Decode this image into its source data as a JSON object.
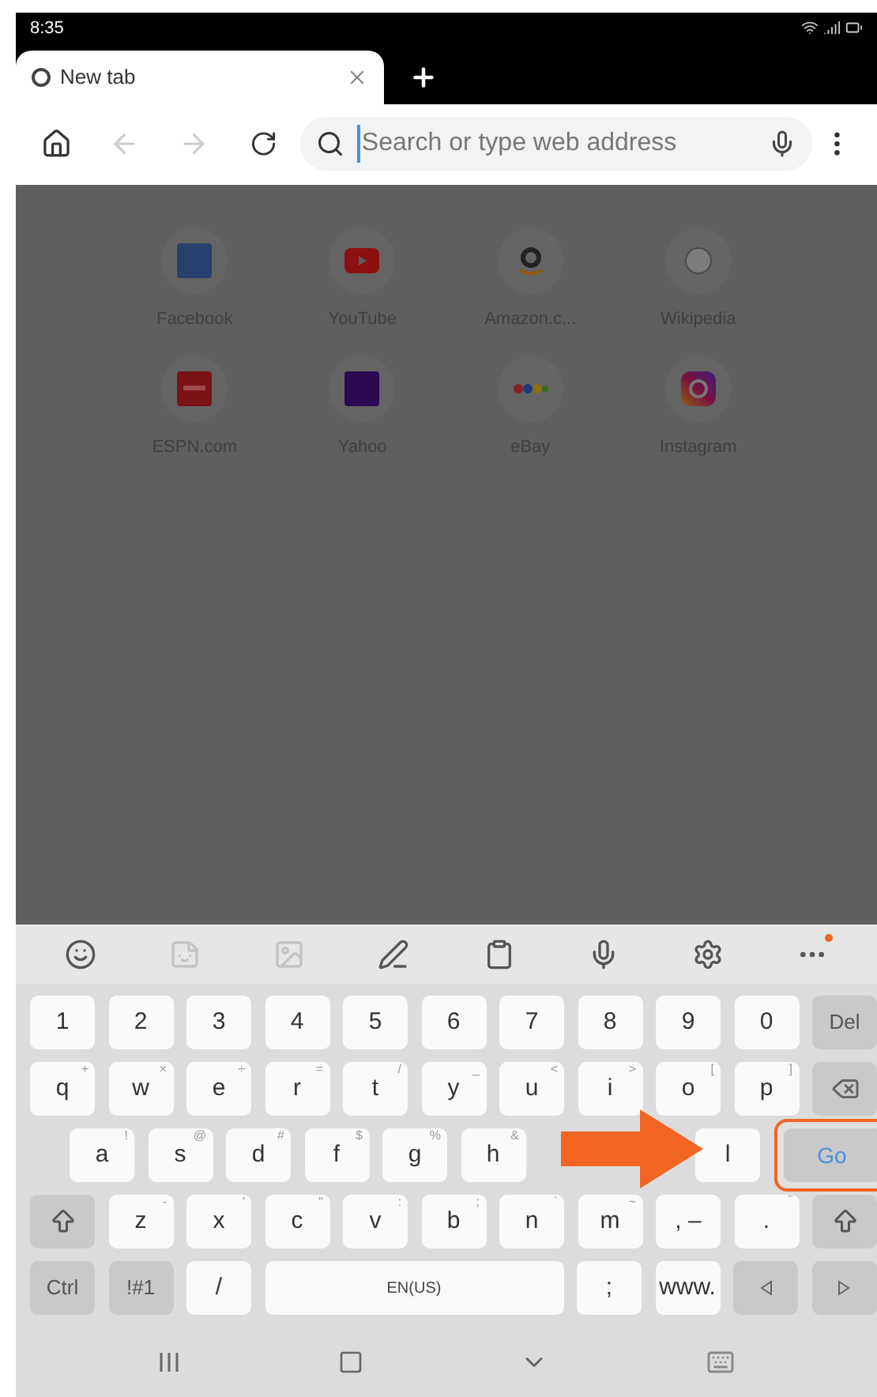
{
  "status_bar": {
    "time": "8:35"
  },
  "tabs": [
    {
      "title": "New tab",
      "selected": true
    }
  ],
  "toolbar": {
    "back_disabled": true,
    "forward_disabled": true
  },
  "address_bar": {
    "placeholder": "Search or type web address"
  },
  "shortcuts": [
    {
      "label": "Facebook",
      "kind": "facebook"
    },
    {
      "label": "YouTube",
      "kind": "youtube"
    },
    {
      "label": "Amazon.c...",
      "kind": "amazon"
    },
    {
      "label": "Wikipedia",
      "kind": "wikipedia"
    },
    {
      "label": "ESPN.com",
      "kind": "espn"
    },
    {
      "label": "Yahoo",
      "kind": "yahoo"
    },
    {
      "label": "eBay",
      "kind": "ebay"
    },
    {
      "label": "Instagram",
      "kind": "instagram"
    }
  ],
  "keyboard_toolbar": [
    {
      "kind": "emoji",
      "disabled": false
    },
    {
      "kind": "sticker",
      "disabled": true
    },
    {
      "kind": "gif",
      "disabled": true
    },
    {
      "kind": "handwriting",
      "disabled": false
    },
    {
      "kind": "clipboard",
      "disabled": false
    },
    {
      "kind": "voice",
      "disabled": false
    },
    {
      "kind": "settings",
      "disabled": false
    },
    {
      "kind": "more",
      "disabled": false,
      "badge": true
    }
  ],
  "key_rows": [
    [
      {
        "label": "1"
      },
      {
        "label": "2"
      },
      {
        "label": "3"
      },
      {
        "label": "4"
      },
      {
        "label": "5"
      },
      {
        "label": "6"
      },
      {
        "label": "7"
      },
      {
        "label": "8"
      },
      {
        "label": "9"
      },
      {
        "label": "0"
      },
      {
        "label": "Del",
        "kind": "function"
      }
    ],
    [
      {
        "label": "q",
        "hint": "+"
      },
      {
        "label": "w",
        "hint": "×"
      },
      {
        "label": "e",
        "hint": "÷"
      },
      {
        "label": "r",
        "hint": "="
      },
      {
        "label": "t",
        "hint": "/"
      },
      {
        "label": "y",
        "hint": "_"
      },
      {
        "label": "u",
        "hint": "<"
      },
      {
        "label": "i",
        "hint": ">"
      },
      {
        "label": "o",
        "hint": "["
      },
      {
        "label": "p",
        "hint": "]"
      },
      {
        "kind": "backspace"
      }
    ],
    [
      {
        "label": "a",
        "hint": "!"
      },
      {
        "label": "s",
        "hint": "@"
      },
      {
        "label": "d",
        "hint": "#"
      },
      {
        "label": "f",
        "hint": "$"
      },
      {
        "label": "g",
        "hint": "%"
      },
      {
        "label": "h",
        "hint": "&"
      },
      {},
      {},
      {
        "label": "l"
      },
      {
        "label": "Go",
        "kind": "action",
        "highlighted": true
      }
    ],
    [
      {
        "kind": "shift"
      },
      {
        "label": "z",
        "hint": "-"
      },
      {
        "label": "x",
        "hint": "'"
      },
      {
        "label": "c",
        "hint": "\""
      },
      {
        "label": "v",
        "hint": ":"
      },
      {
        "label": "b",
        "hint": ";"
      },
      {
        "label": "n",
        "hint": "`"
      },
      {
        "label": "m",
        "hint": "~"
      },
      {
        "label": ", –",
        "kind": "letter"
      },
      {
        "label": ".",
        "hint": "‾"
      },
      {
        "kind": "shift"
      }
    ],
    [
      {
        "label": "Ctrl",
        "kind": "function"
      },
      {
        "label": "!#1",
        "kind": "function"
      },
      {
        "label": "/"
      },
      {
        "label": "EN(US)",
        "kind": "space"
      },
      {
        "label": ";"
      },
      {
        "label": "www."
      },
      {
        "kind": "left"
      },
      {
        "kind": "right"
      }
    ]
  ],
  "pointer_arrow": true
}
